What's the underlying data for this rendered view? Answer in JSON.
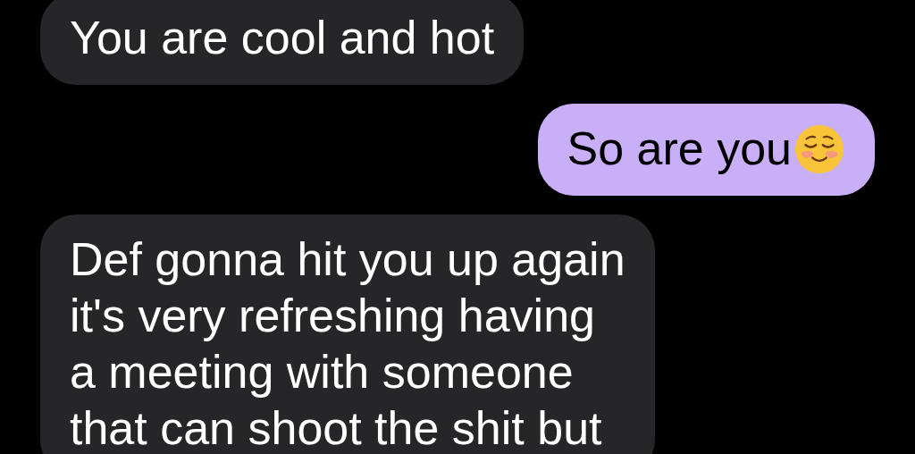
{
  "messages": [
    {
      "kind": "received",
      "lines": [
        "You are cool and hot"
      ],
      "emoji": false
    },
    {
      "kind": "sent",
      "lines": [
        "So are you"
      ],
      "emoji": true
    },
    {
      "kind": "received",
      "lines": [
        "Def gonna hit you up again",
        "it's very refreshing having",
        "a meeting with someone",
        "that can shoot the shit but"
      ],
      "emoji": false
    }
  ]
}
